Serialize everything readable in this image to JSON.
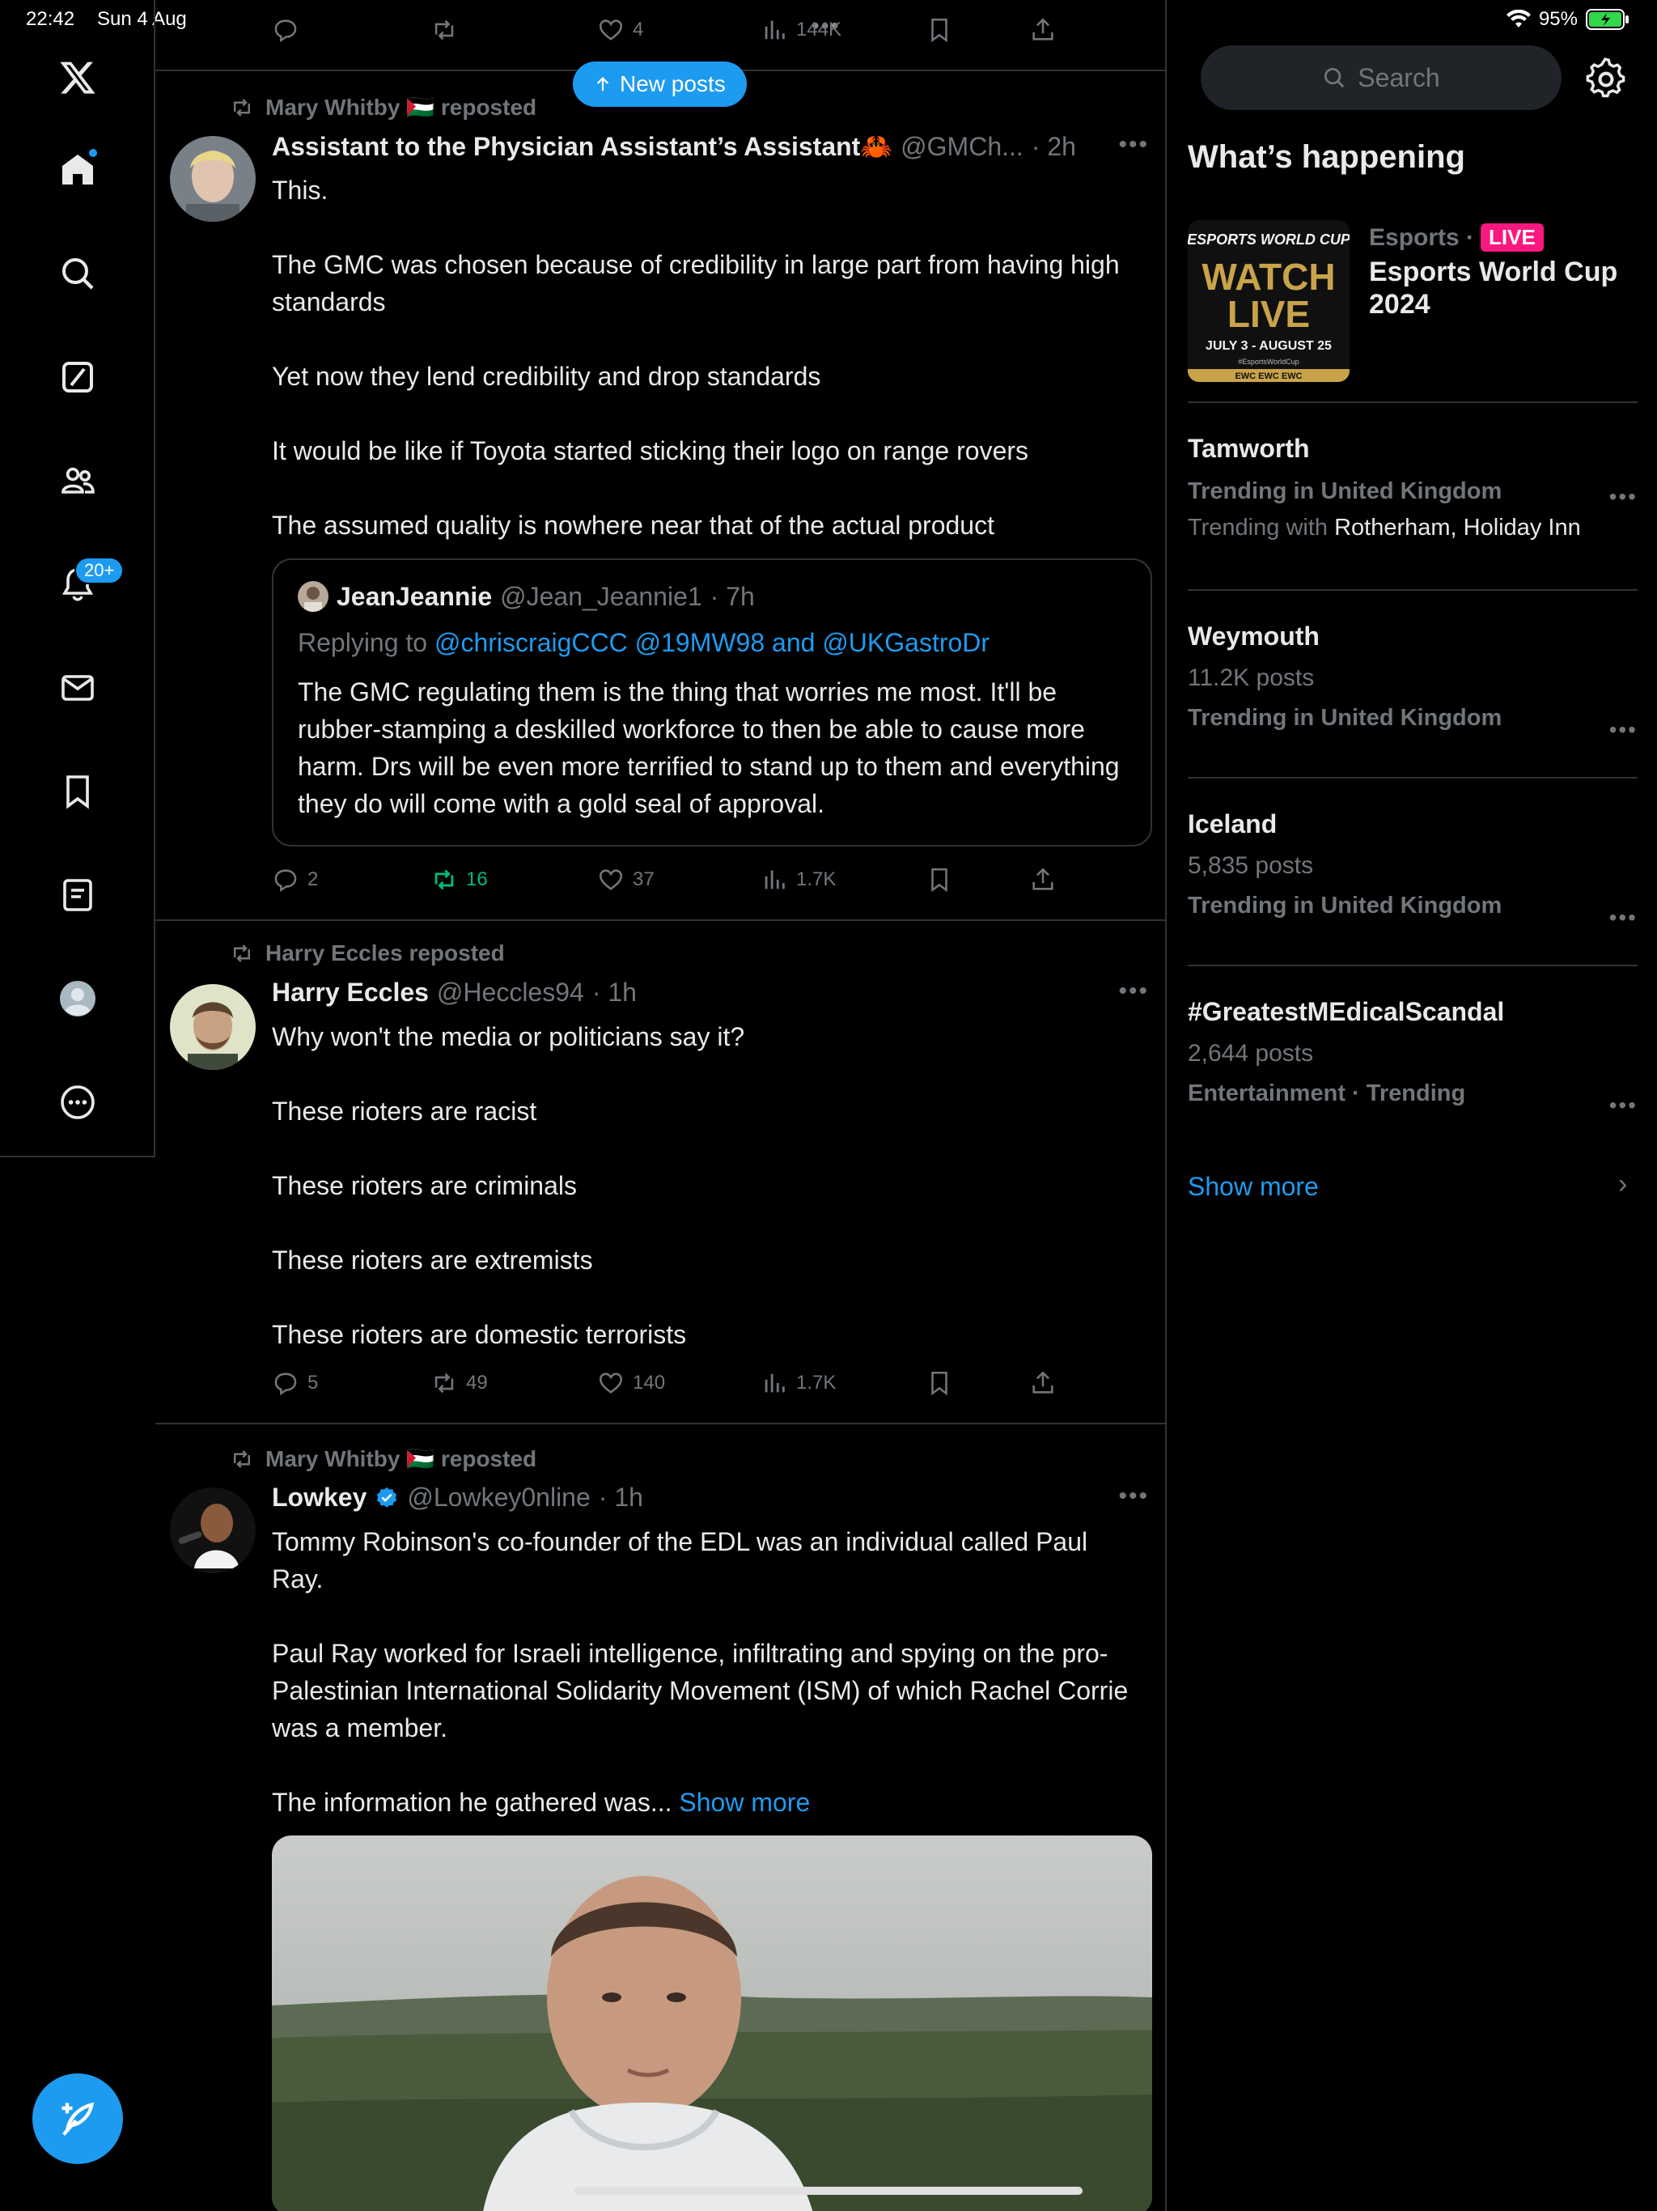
{
  "status": {
    "time": "22:42",
    "date": "Sun 4 Aug",
    "battery": "95%"
  },
  "nav": {
    "notifications_badge": "20+"
  },
  "feed": {
    "new_posts_label": "New posts",
    "top_actions": {
      "likes": "4",
      "views": "144K"
    },
    "tweets": [
      {
        "repost_by": "Mary Whitby 🇵🇸 reposted",
        "name": "Assistant to the Physician Assistant’s Assistant🦀",
        "handle": "@GMCh...",
        "time": "· 2h",
        "paragraphs": [
          "This.",
          "The GMC was chosen because of credibility in large part from having high standards",
          "Yet now they lend credibility and drop standards",
          "It would be like if Toyota started sticking their logo on range rovers",
          "The assumed quality is nowhere near that of the actual product"
        ],
        "quote": {
          "name": "JeanJeannie",
          "handle": "@Jean_Jeannie1",
          "time": "· 7h",
          "replying_prefix": "Replying to",
          "replying_to": "@chriscraigCCC @19MW98 and @UKGastroDr",
          "text": "The GMC regulating them is the thing that worries me most. It'll be rubber-stamping a deskilled workforce to then be able to cause more harm. Drs will be even more terrified to stand up to them and everything they do will come with a gold seal of approval."
        },
        "replies": "2",
        "reposts": "16",
        "likes": "37",
        "views": "1.7K"
      },
      {
        "repost_by": "Harry Eccles reposted",
        "name": "Harry Eccles",
        "handle": "@Heccles94",
        "time": "· 1h",
        "paragraphs": [
          "Why won't the media or politicians say it?",
          "These rioters are racist",
          "These rioters are criminals",
          "These rioters are extremists",
          "These rioters are domestic terrorists"
        ],
        "replies": "5",
        "reposts": "49",
        "likes": "140",
        "views": "1.7K"
      },
      {
        "repost_by": "Mary Whitby 🇵🇸 reposted",
        "name": "Lowkey",
        "handle": "@Lowkey0nline",
        "time": "· 1h",
        "paragraphs": [
          "Tommy Robinson's co-founder of the EDL was an individual called Paul Ray.",
          "Paul Ray worked for Israeli intelligence, infiltrating and spying on the pro-Palestinian International Solidarity Movement (ISM) of which Rachel Corrie was a member."
        ],
        "truncated_text": "The information he gathered was...",
        "show_more": "Show more"
      }
    ]
  },
  "sidebar": {
    "search_placeholder": "Search",
    "whats_happening": "What’s happening",
    "live": {
      "category": "Esports ·",
      "badge": "LIVE",
      "title": "Esports World Cup 2024",
      "img_top": "ESPORTS WORLD CUP",
      "img_main1": "WATCH",
      "img_main2": "LIVE",
      "img_dates": "JULY 3 - AUGUST 25",
      "img_tag": "#EsportsWorldCup",
      "img_strip": "EWC EWC EWC"
    },
    "trends": [
      {
        "name": "Tamworth",
        "context": "Trending in United Kingdom",
        "with_prefix": "Trending with",
        "with": "Rotherham, Holiday Inn"
      },
      {
        "name": "Weymouth",
        "posts": "11.2K posts",
        "context": "Trending in United Kingdom"
      },
      {
        "name": "Iceland",
        "posts": "5,835 posts",
        "context": "Trending in United Kingdom"
      },
      {
        "name": "#GreatestMEdicalScandal",
        "posts": "2,644 posts",
        "context": "Entertainment · Trending"
      }
    ],
    "show_more": "Show more"
  },
  "colors": {
    "accent": "#1d9bf0",
    "repost_green": "#00ba7c",
    "live_pink": "#f91880",
    "background": "#000000",
    "muted": "#71767b"
  }
}
